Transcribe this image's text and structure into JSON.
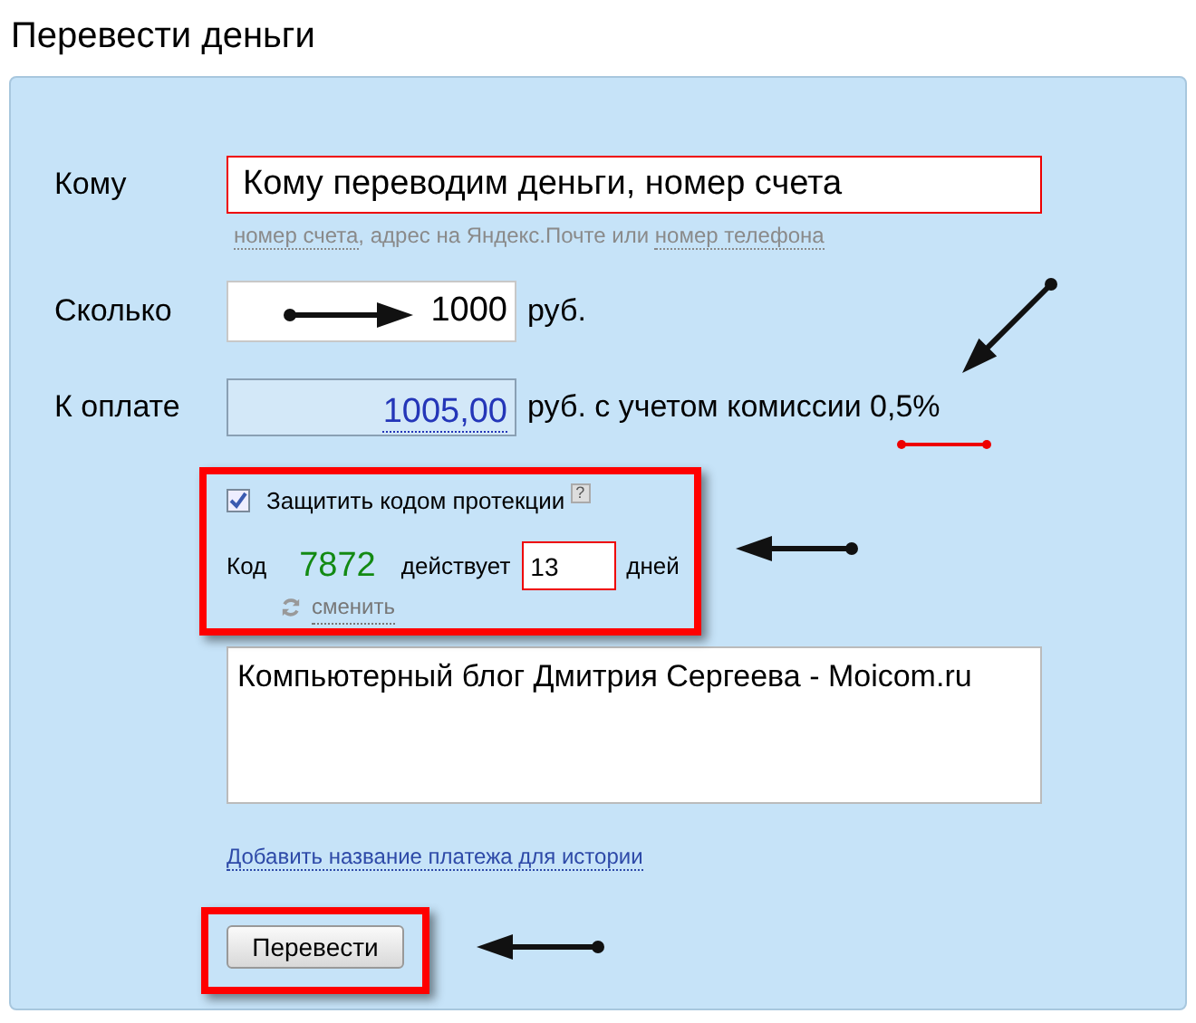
{
  "title": "Перевести деньги",
  "recipient": {
    "label": "Кому",
    "value": "Кому переводим деньги, номер счета",
    "hint": [
      {
        "text": "номер счета",
        "kind": "link"
      },
      {
        "text": ", адрес на Яндекс.Почте или ",
        "kind": "text"
      },
      {
        "text": "номер телефона",
        "kind": "link"
      }
    ]
  },
  "amount": {
    "label": "Сколько",
    "value": "1000",
    "unit": "руб."
  },
  "payment": {
    "label": "К оплате",
    "value": "1005,00",
    "note": "руб. с учетом комиссии 0,5%"
  },
  "protection": {
    "label": "Защитить кодом протекции",
    "checked": true,
    "help": "?",
    "code_label": "Код",
    "code": "7872",
    "valid_label": "действует",
    "days": "13",
    "days_unit": "дней",
    "change_link": "сменить"
  },
  "comment": {
    "value": "Компьютерный блог Дмитрия Сергеева - Moicom.ru"
  },
  "history_link": "Добавить название платежа для истории",
  "submit": "Перевести"
}
